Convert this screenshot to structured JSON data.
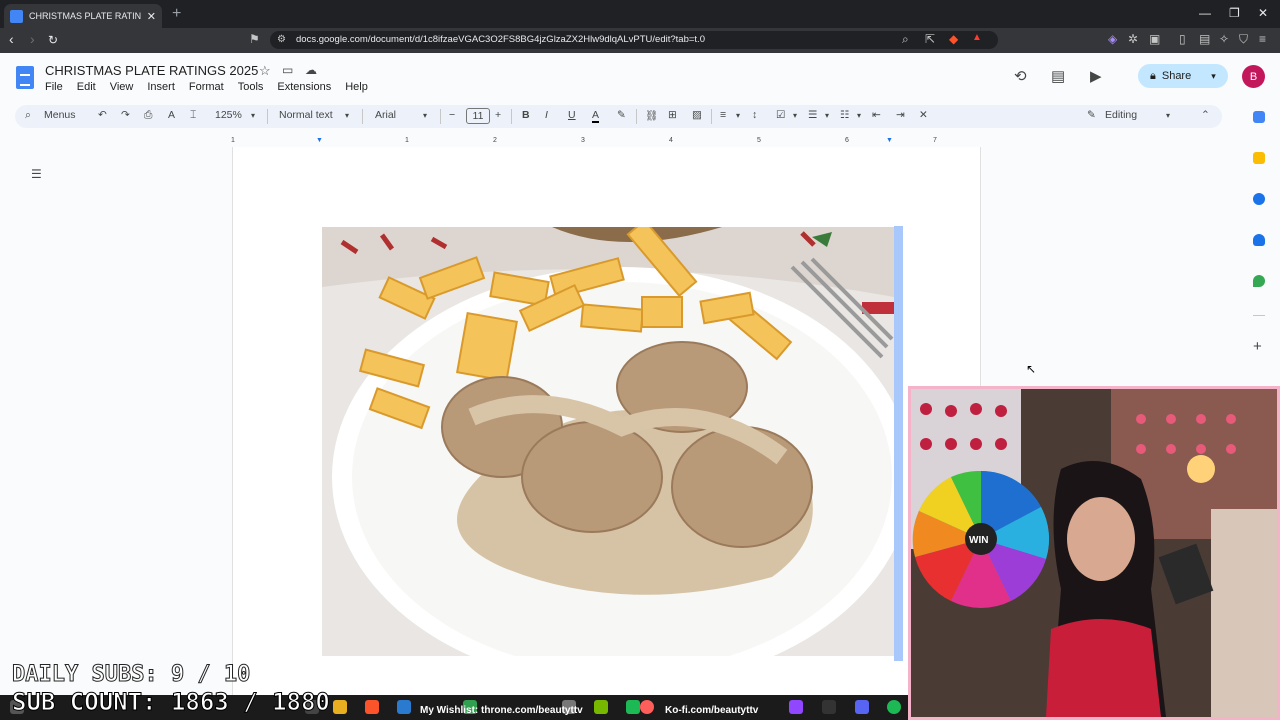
{
  "browser": {
    "tab_title": "CHRISTMAS PLATE RATINGS 202",
    "url": "docs.google.com/document/d/1c8ifzaeVGAC3O2FS8BG4jzGlzaZX2Hlw9dlqALvPTU/edit?tab=t.0"
  },
  "doc": {
    "title": "CHRISTMAS PLATE RATINGS 2025",
    "menus": [
      "File",
      "Edit",
      "View",
      "Insert",
      "Format",
      "Tools",
      "Extensions",
      "Help"
    ],
    "share_label": "Share",
    "avatar_initial": "B"
  },
  "toolbar": {
    "search_label": "Menus",
    "zoom": "125%",
    "style": "Normal text",
    "font": "Arial",
    "font_size": "11",
    "mode": "Editing"
  },
  "ruler": {
    "marks": [
      "1",
      "1",
      "2",
      "3",
      "4",
      "5",
      "6",
      "7"
    ]
  },
  "stream_overlay": {
    "daily_subs": "DAILY SUBS: 9 / 10",
    "sub_count": "SUB COUNT: 1863 / 1880",
    "wishlist": "My Wishlist: throne.com/beautyttv",
    "kofi": "Ko-fi.com/beautyttv",
    "wheel_label": "WIN"
  },
  "colors": {
    "accent": "#1a73e8",
    "share_bg": "#c2e7ff",
    "webcam_border": "#f4b3c8"
  }
}
